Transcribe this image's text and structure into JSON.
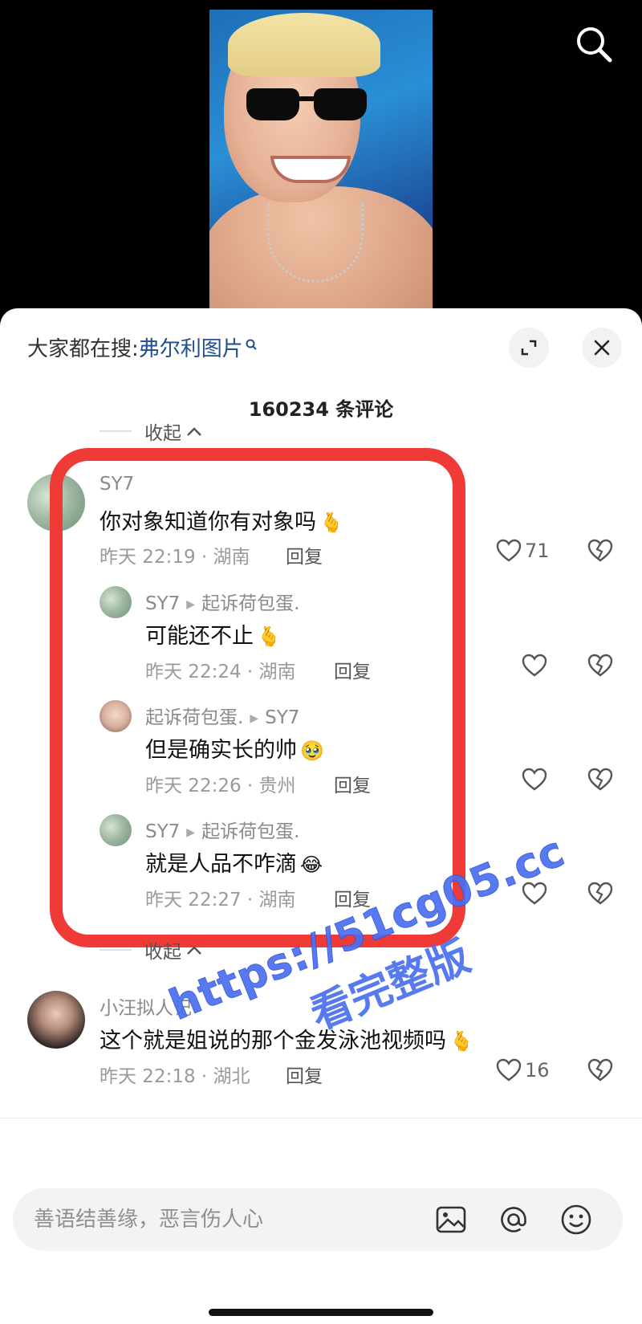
{
  "sheet": {
    "search_prompt": "大家都在搜:",
    "search_term": "弗尔利图片",
    "comment_count": "160234 条评论",
    "collapse_label": "收起"
  },
  "comments": [
    {
      "name": "SY7",
      "text": "你对象知道你有对象吗",
      "emoji": "🫰",
      "time": "昨天 22:19 · 湖南",
      "reply": "回复",
      "likes": "71"
    },
    {
      "name": "SY7",
      "reply_to": "起诉荷包蛋.",
      "text": "可能还不止",
      "emoji": "🫰",
      "time": "昨天 22:24 · 湖南",
      "reply": "回复"
    },
    {
      "name": "起诉荷包蛋.",
      "reply_to": "SY7",
      "text": "但是确实长的帅",
      "emoji": "🥹",
      "time": "昨天 22:26 · 贵州",
      "reply": "回复"
    },
    {
      "name": "SY7",
      "reply_to": "起诉荷包蛋.",
      "text": "就是人品不咋滴",
      "emoji": "😂",
      "time": "昨天 22:27 · 湖南",
      "reply": "回复"
    },
    {
      "name": "小汪拟人记",
      "text": "这个就是姐说的那个金发泳池视频吗",
      "emoji": "🫰",
      "time": "昨天 22:18 · 湖北",
      "reply": "回复",
      "likes": "16"
    }
  ],
  "input": {
    "placeholder": "善语结善缘，恶言伤人心"
  },
  "watermark": {
    "line1": "https://51cg05.cc",
    "line2": "看完整版"
  },
  "colors": {
    "highlight": "#ef3a36",
    "link": "#1f4f8f",
    "watermark": "#4a6ff0"
  }
}
